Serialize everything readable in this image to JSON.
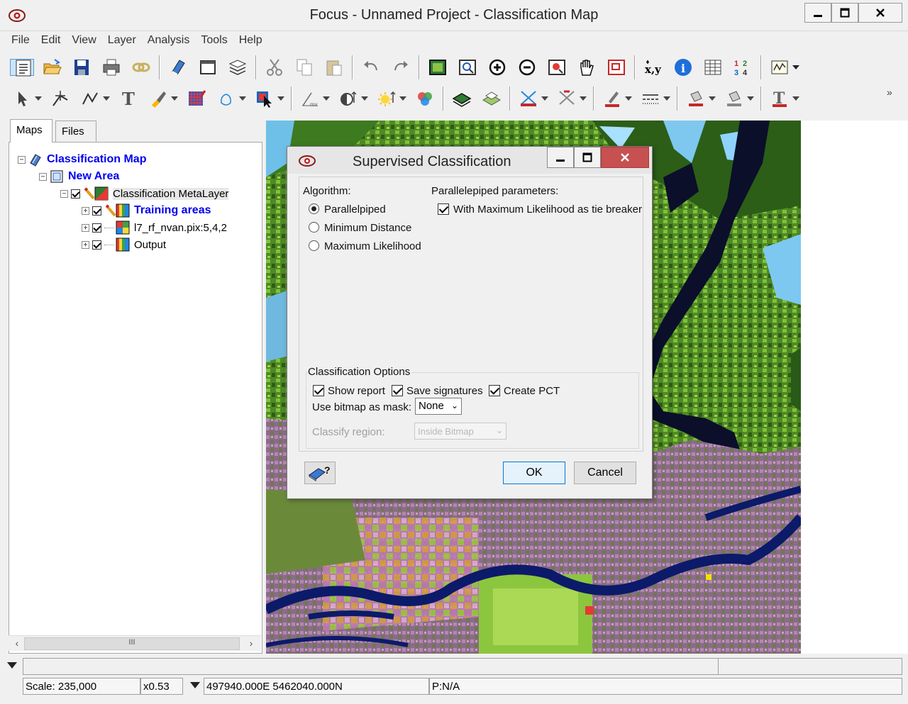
{
  "window": {
    "title": "Focus - Unnamed Project - Classification Map"
  },
  "menu": [
    "File",
    "Edit",
    "View",
    "Layer",
    "Analysis",
    "Tools",
    "Help"
  ],
  "toolbar1": [
    "new-icon",
    "open-icon",
    "save-icon",
    "print-icon",
    "properties-icon",
    "link-icon",
    "eraser-icon",
    "window-icon",
    "layers-icon",
    "cut-icon",
    "copy-icon",
    "paste-icon",
    "undo-icon",
    "redo-icon",
    "zoom-extent-icon",
    "zoom-box-icon",
    "zoom-in-icon",
    "zoom-out-icon",
    "zoom-layer-icon",
    "pan-icon",
    "overview-icon",
    "xy-coordinates-icon",
    "info-icon",
    "table-icon",
    "numbers-icon",
    "histogram-icon"
  ],
  "toolbar2": [
    "select-icon",
    "vertex-icon",
    "polyline-icon",
    "text-icon",
    "brush-icon",
    "grid-icon",
    "fill-icon",
    "cursor-icon",
    "function-icon",
    "contrast-icon",
    "brightness-icon",
    "rgb-icon",
    "layer-add-icon",
    "layer-stack-icon",
    "cross-icon",
    "crosshair-icon",
    "pen-icon",
    "line-style-icon",
    "paint-icon",
    "paint-fill-icon",
    "font-icon"
  ],
  "panel": {
    "tabs": [
      "Maps",
      "Files"
    ],
    "tree": [
      {
        "label": "Classification Map",
        "style": "blue"
      },
      {
        "label": "New Area",
        "style": "blue"
      },
      {
        "label": "Classification MetaLayer",
        "style": "hl"
      },
      {
        "label": "Training areas",
        "style": "blue"
      },
      {
        "label": "l7_rf_nvan.pix:5,4,2",
        "style": "normal"
      },
      {
        "label": "Output",
        "style": "normal"
      }
    ],
    "scroll_thumb": "III"
  },
  "dialog": {
    "title": "Supervised Classification",
    "algorithm_label": "Algorithm:",
    "algorithms": [
      "Parallelpiped",
      "Minimum Distance",
      "Maximum Likelihood"
    ],
    "selected_algorithm": "Parallelpiped",
    "params_label": "Parallelepiped parameters:",
    "tie_breaker": "With Maximum Likelihood as tie breaker",
    "options_label": "Classification Options",
    "show_report": "Show report",
    "save_signatures": "Save signatures",
    "create_pct": "Create PCT",
    "bitmap_mask_label": "Use bitmap as mask:",
    "bitmap_mask_value": "None",
    "classify_region_label": "Classify region:",
    "classify_region_value": "Inside Bitmap",
    "ok": "OK",
    "cancel": "Cancel"
  },
  "status": {
    "scale": "Scale: 235,000",
    "zoom": "x0.53",
    "coords": "497940.000E 5462040.000N",
    "pixel": "P:N/A"
  }
}
